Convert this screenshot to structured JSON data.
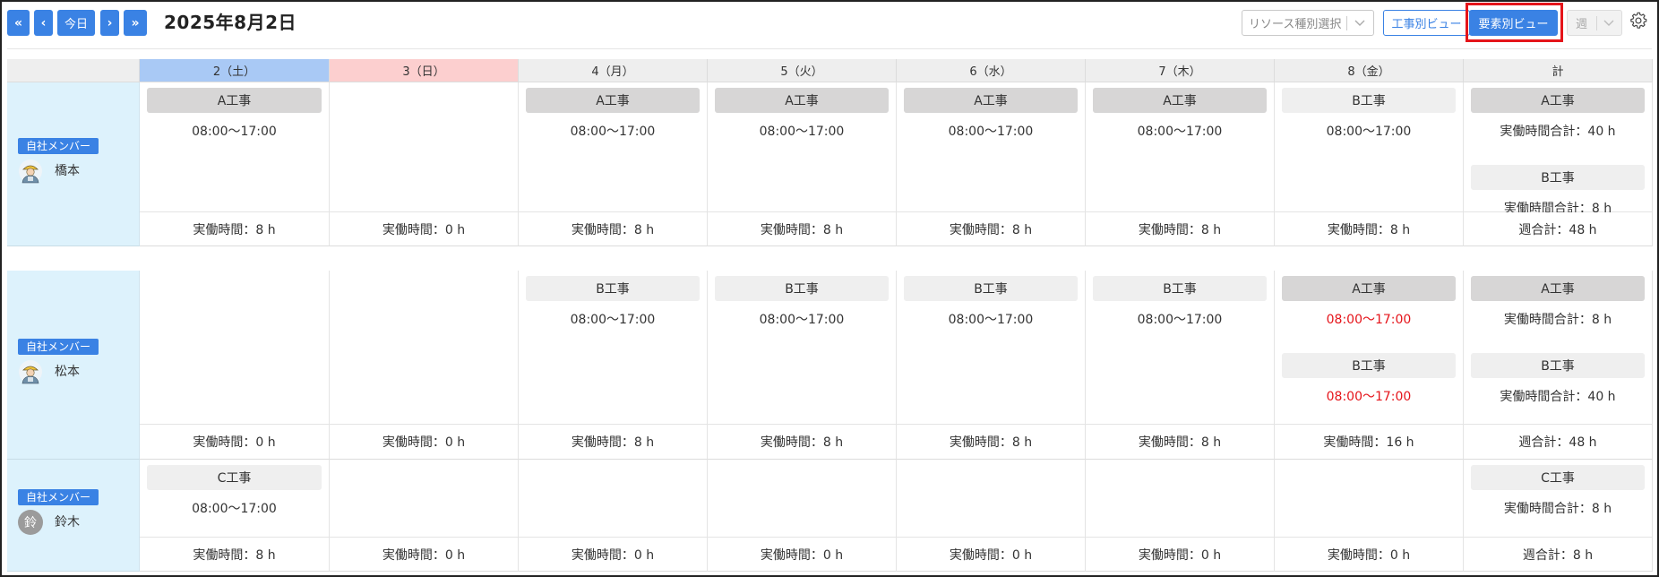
{
  "toolbar": {
    "prev_prev": "«",
    "prev": "‹",
    "today": "今日",
    "next": "›",
    "next_next": "»",
    "title": "2025年8月2日",
    "resource_select_placeholder": "リソース種別選択",
    "view_by_job": "工事別ビュー",
    "view_by_element": "要素別ビュー",
    "period": "週"
  },
  "colors": {
    "accent": "#3a82e4",
    "highlight": "#e5141a",
    "saturday": "#a9c9f5",
    "sunday": "#fccfcf",
    "member_bg": "#ddf2fc"
  },
  "columns": [
    "2（土）",
    "3（日）",
    "4（月）",
    "5（火）",
    "6（水）",
    "7（木）",
    "8（金）",
    "計"
  ],
  "members": [
    {
      "badge": "自社メンバー",
      "name": "橋本",
      "avatar": "worker-avatar-icon",
      "days": [
        {
          "jobs": [
            {
              "name": "A工事",
              "time": "08:00〜17:00"
            }
          ],
          "footer": "実働時間：8 h"
        },
        {
          "jobs": [],
          "footer": "実働時間：0 h"
        },
        {
          "jobs": [
            {
              "name": "A工事",
              "time": "08:00〜17:00"
            }
          ],
          "footer": "実働時間：8 h"
        },
        {
          "jobs": [
            {
              "name": "A工事",
              "time": "08:00〜17:00"
            }
          ],
          "footer": "実働時間：8 h"
        },
        {
          "jobs": [
            {
              "name": "A工事",
              "time": "08:00〜17:00"
            }
          ],
          "footer": "実働時間：8 h"
        },
        {
          "jobs": [
            {
              "name": "A工事",
              "time": "08:00〜17:00"
            }
          ],
          "footer": "実働時間：8 h"
        },
        {
          "jobs": [
            {
              "name": "B工事",
              "time": "08:00〜17:00"
            }
          ],
          "footer": "実働時間：8 h"
        }
      ],
      "total": {
        "items": [
          {
            "name": "A工事",
            "sum": "実働時間合計：40 h"
          },
          {
            "name": "B工事",
            "sum": "実働時間合計：8 h"
          }
        ],
        "footer": "週合計：48 h"
      }
    },
    {
      "badge": "自社メンバー",
      "name": "松本",
      "avatar": "worker-avatar-icon",
      "days": [
        {
          "jobs": [],
          "footer": "実働時間：0 h"
        },
        {
          "jobs": [],
          "footer": "実働時間：0 h"
        },
        {
          "jobs": [
            {
              "name": "B工事",
              "time": "08:00〜17:00"
            }
          ],
          "footer": "実働時間：8 h"
        },
        {
          "jobs": [
            {
              "name": "B工事",
              "time": "08:00〜17:00"
            }
          ],
          "footer": "実働時間：8 h"
        },
        {
          "jobs": [
            {
              "name": "B工事",
              "time": "08:00〜17:00"
            }
          ],
          "footer": "実働時間：8 h"
        },
        {
          "jobs": [
            {
              "name": "B工事",
              "time": "08:00〜17:00"
            }
          ],
          "footer": "実働時間：8 h"
        },
        {
          "jobs": [
            {
              "name": "A工事",
              "time": "08:00〜17:00"
            },
            {
              "name": "B工事",
              "time": "08:00〜17:00"
            }
          ],
          "footer": "実働時間：16 h"
        }
      ],
      "total": {
        "items": [
          {
            "name": "A工事",
            "sum": "実働時間合計：8 h"
          },
          {
            "name": "B工事",
            "sum": "実働時間合計：40 h"
          }
        ],
        "footer": "週合計：48 h"
      }
    },
    {
      "badge": "自社メンバー",
      "name": "鈴木",
      "avatar_initial": "鈴",
      "days": [
        {
          "jobs": [
            {
              "name": "C工事",
              "time": "08:00〜17:00"
            }
          ],
          "footer": "実働時間：8 h"
        },
        {
          "jobs": [],
          "footer": "実働時間：0 h"
        },
        {
          "jobs": [],
          "footer": "実働時間：0 h"
        },
        {
          "jobs": [],
          "footer": "実働時間：0 h"
        },
        {
          "jobs": [],
          "footer": "実働時間：0 h"
        },
        {
          "jobs": [],
          "footer": "実働時間：0 h"
        },
        {
          "jobs": [],
          "footer": "実働時間：0 h"
        }
      ],
      "total": {
        "items": [
          {
            "name": "C工事",
            "sum": "実働時間合計：8 h"
          }
        ],
        "footer": "週合計：8 h"
      }
    }
  ]
}
